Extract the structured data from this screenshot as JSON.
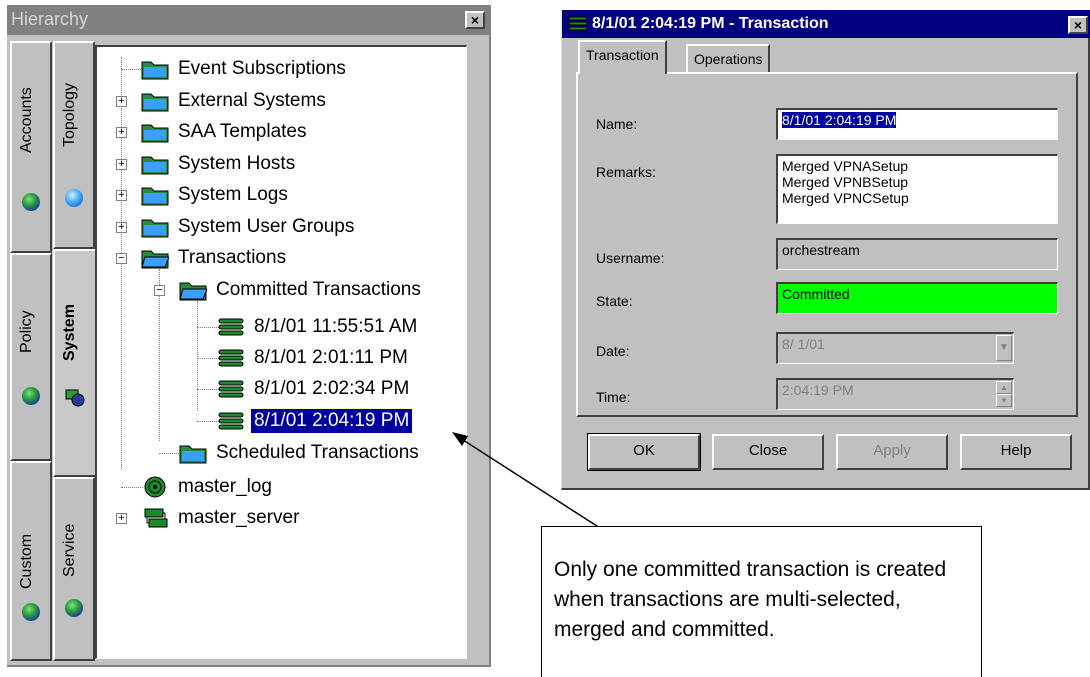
{
  "hierarchy": {
    "title": "Hierarchy",
    "close_glyph": "×",
    "side_tabs": [
      {
        "label": "Accounts",
        "icon": "globe-icon"
      },
      {
        "label": "Topology",
        "icon": "globe-network-icon"
      },
      {
        "label": "Policy",
        "icon": "globe-icon"
      },
      {
        "label": "System",
        "icon": "system-icon"
      },
      {
        "label": "Custom",
        "icon": "globe-icon"
      },
      {
        "label": "Service",
        "icon": "globe-icon"
      }
    ],
    "tree": [
      {
        "label": "Event Subscriptions",
        "icon": "folder-icon"
      },
      {
        "label": "External Systems",
        "icon": "folder-icon",
        "expander": "+"
      },
      {
        "label": "SAA Templates",
        "icon": "folder-icon",
        "expander": "+"
      },
      {
        "label": "System Hosts",
        "icon": "folder-icon",
        "expander": "+"
      },
      {
        "label": "System Logs",
        "icon": "folder-icon",
        "expander": "+"
      },
      {
        "label": "System User Groups",
        "icon": "folder-icon",
        "expander": "+"
      },
      {
        "label": "Transactions",
        "icon": "folder-open-icon",
        "expander": "−"
      },
      {
        "label": "Committed Transactions",
        "icon": "folder-open-icon",
        "expander": "−"
      },
      {
        "label": "8/1/01 11:55:51 AM",
        "icon": "transaction-icon"
      },
      {
        "label": "8/1/01 2:01:11 PM",
        "icon": "transaction-icon"
      },
      {
        "label": "8/1/01 2:02:34 PM",
        "icon": "transaction-icon"
      },
      {
        "label": "8/1/01 2:04:19 PM",
        "icon": "transaction-icon",
        "selected": true
      },
      {
        "label": "Scheduled Transactions",
        "icon": "folder-icon"
      },
      {
        "label": "master_log",
        "icon": "log-icon"
      },
      {
        "label": "master_server",
        "icon": "server-icon",
        "expander": "+"
      }
    ]
  },
  "dialog": {
    "title": "8/1/01 2:04:19 PM - Transaction",
    "close_glyph": "×",
    "tabs": [
      "Transaction",
      "Operations"
    ],
    "fields": {
      "name_label": "Name:",
      "name_value": "8/1/01 2:04:19 PM",
      "remarks_label": "Remarks:",
      "remarks_lines": [
        "Merged VPNASetup",
        "Merged VPNBSetup",
        "Merged VPNCSetup"
      ],
      "username_label": "Username:",
      "username_value": "orchestream",
      "state_label": "State:",
      "state_value": "Committed",
      "date_label": "Date:",
      "date_value": "8/ 1/01",
      "time_label": "Time:",
      "time_value": "2:04:19 PM"
    },
    "buttons": {
      "ok": "OK",
      "close": "Close",
      "apply": "Apply",
      "help": "Help"
    },
    "colors": {
      "title_bar": "#000080",
      "state_bg": "#00ff00",
      "selection": "#0000a0"
    }
  },
  "callout": {
    "text": "Only one committed transaction is created when transactions are multi-selected, merged and committed."
  }
}
